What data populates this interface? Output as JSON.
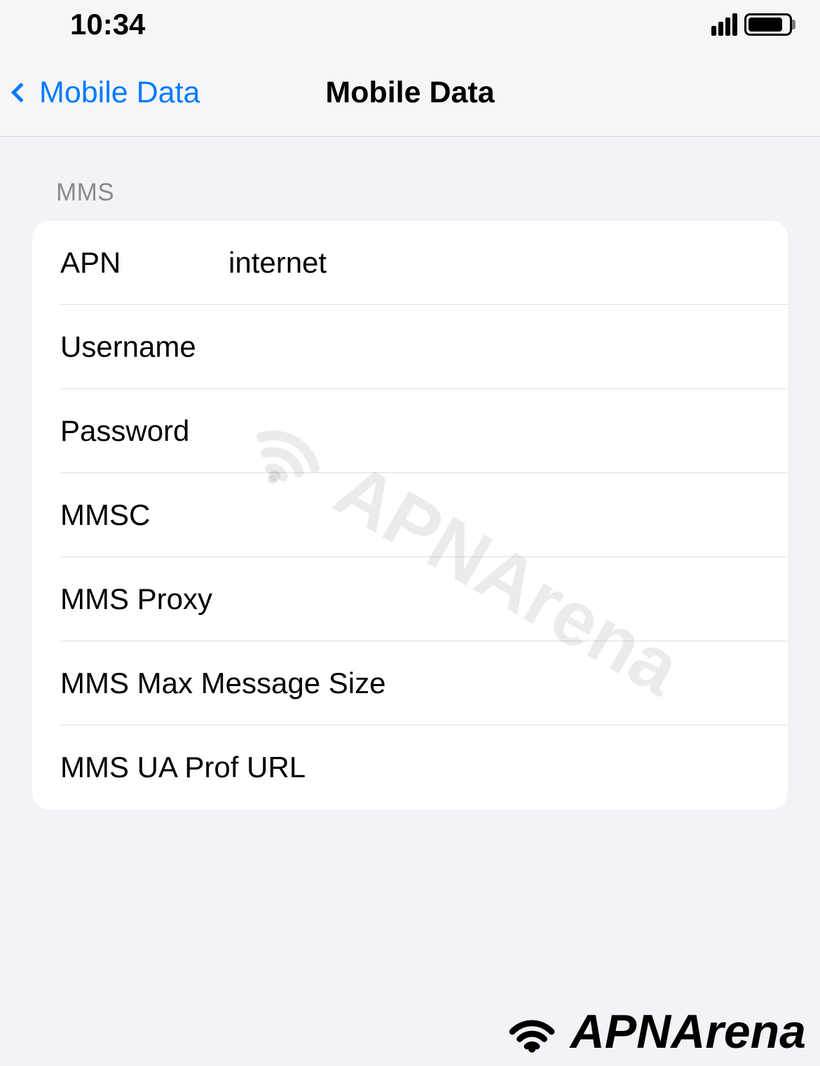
{
  "status": {
    "time": "10:34"
  },
  "nav": {
    "back_label": "Mobile Data",
    "title": "Mobile Data"
  },
  "section": {
    "header": "MMS"
  },
  "fields": {
    "apn": {
      "label": "APN",
      "value": "internet"
    },
    "username": {
      "label": "Username",
      "value": ""
    },
    "password": {
      "label": "Password",
      "value": ""
    },
    "mmsc": {
      "label": "MMSC",
      "value": ""
    },
    "mms_proxy": {
      "label": "MMS Proxy",
      "value": ""
    },
    "mms_max_size": {
      "label": "MMS Max Message Size",
      "value": ""
    },
    "mms_ua_prof": {
      "label": "MMS UA Prof URL",
      "value": ""
    }
  },
  "watermark": "APNArena",
  "brand": "APNArena"
}
